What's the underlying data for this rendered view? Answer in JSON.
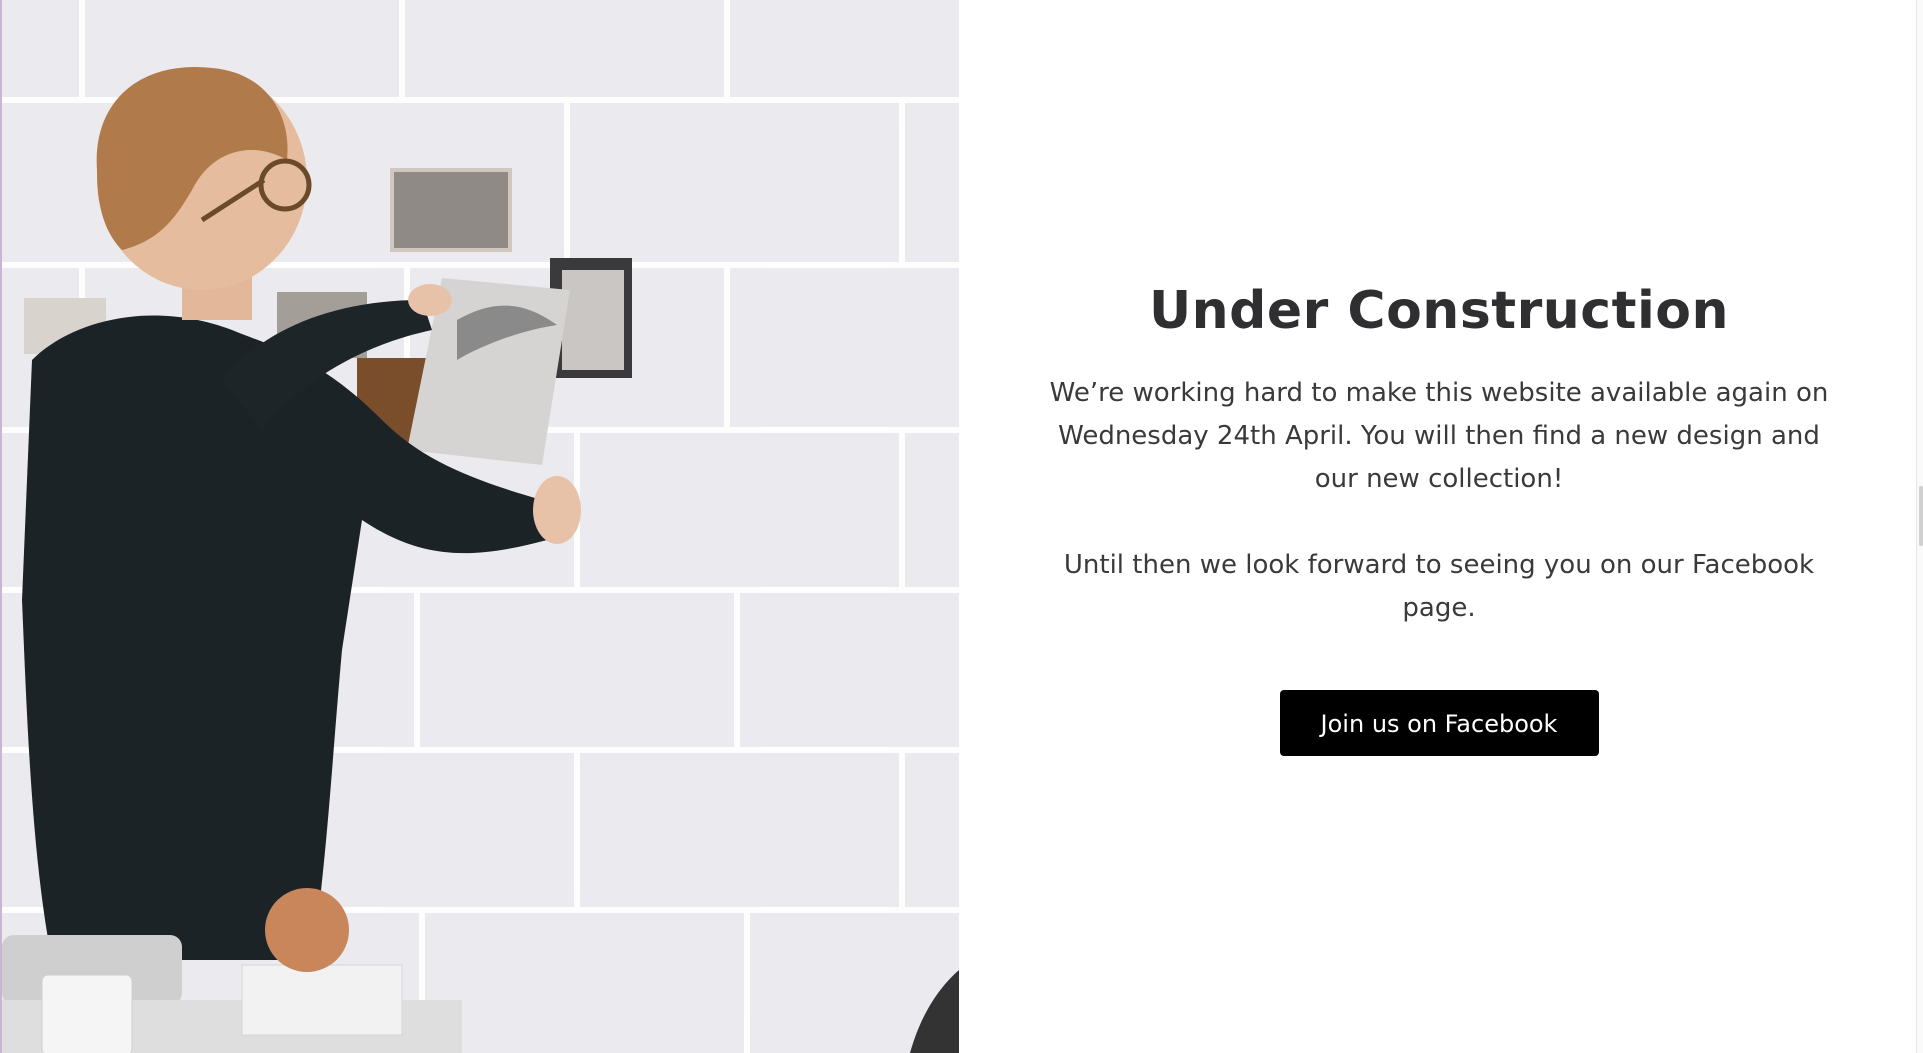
{
  "hero": {
    "image_description": "decorative photo",
    "alt": ""
  },
  "main": {
    "title": "Under Construction",
    "paragraph_1": "We’re working hard to make this website available again on Wednesday 24th April. You will then find a new design and our new collection!",
    "paragraph_2": "Until then we look forward to seeing you on our Facebook page.",
    "cta_label": "Join us on Facebook"
  },
  "colors": {
    "button_bg": "#000000",
    "button_text": "#ffffff",
    "heading": "#2f2f31",
    "body_text": "#3a3a3a",
    "wall": "#e9e8ec"
  }
}
